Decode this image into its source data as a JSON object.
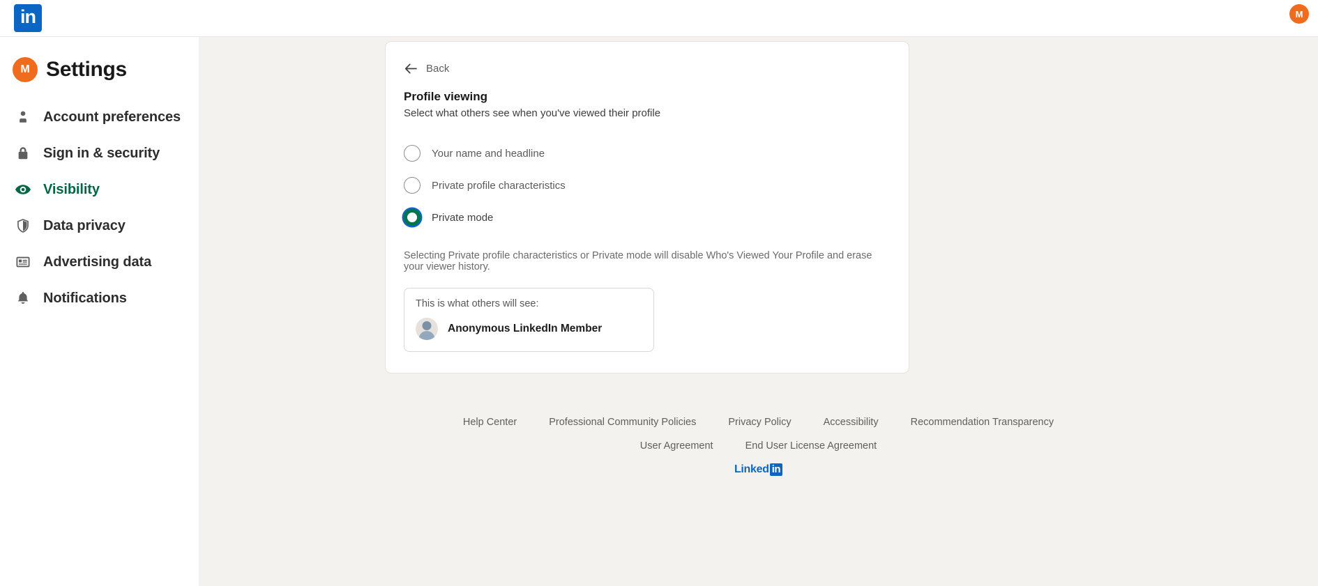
{
  "topbar": {
    "logo_icon": "linkedin-logo-icon",
    "logo_text": "in",
    "me_avatar_initial": "M"
  },
  "sidebar": {
    "avatar_initial": "M",
    "title": "Settings",
    "items": [
      {
        "label": "Account preferences",
        "icon": "person-icon",
        "active": false
      },
      {
        "label": "Sign in & security",
        "icon": "lock-icon",
        "active": false
      },
      {
        "label": "Visibility",
        "icon": "eye-icon",
        "active": true
      },
      {
        "label": "Data privacy",
        "icon": "shield-icon",
        "active": false
      },
      {
        "label": "Advertising data",
        "icon": "card-list-icon",
        "active": false
      },
      {
        "label": "Notifications",
        "icon": "bell-icon",
        "active": false
      }
    ]
  },
  "card": {
    "back_label": "Back",
    "back_icon": "arrow-left-icon",
    "title": "Profile viewing",
    "subtitle": "Select what others see when you've viewed their profile",
    "options": [
      {
        "label": "Your name and headline",
        "selected": false
      },
      {
        "label": "Private profile characteristics",
        "selected": false
      },
      {
        "label": "Private mode",
        "selected": true
      }
    ],
    "helper_text": "Selecting Private profile characteristics or Private mode will disable Who's Viewed Your Profile and erase your viewer history.",
    "preview": {
      "caption": "This is what others will see:",
      "avatar_icon": "anonymous-person-icon",
      "name": "Anonymous LinkedIn Member"
    }
  },
  "footer": {
    "row1": [
      "Help Center",
      "Professional Community Policies",
      "Privacy Policy",
      "Accessibility",
      "Recommendation Transparency"
    ],
    "row2": [
      "User Agreement",
      "End User License Agreement"
    ],
    "logo_text": "Linked",
    "logo_mark": "in"
  },
  "colors": {
    "brand_blue": "#0a66c2",
    "active_green": "#056646",
    "selected_radio_green": "#04754a",
    "avatar_orange": "#ef6c1f",
    "content_bg": "#f4f2ee"
  }
}
